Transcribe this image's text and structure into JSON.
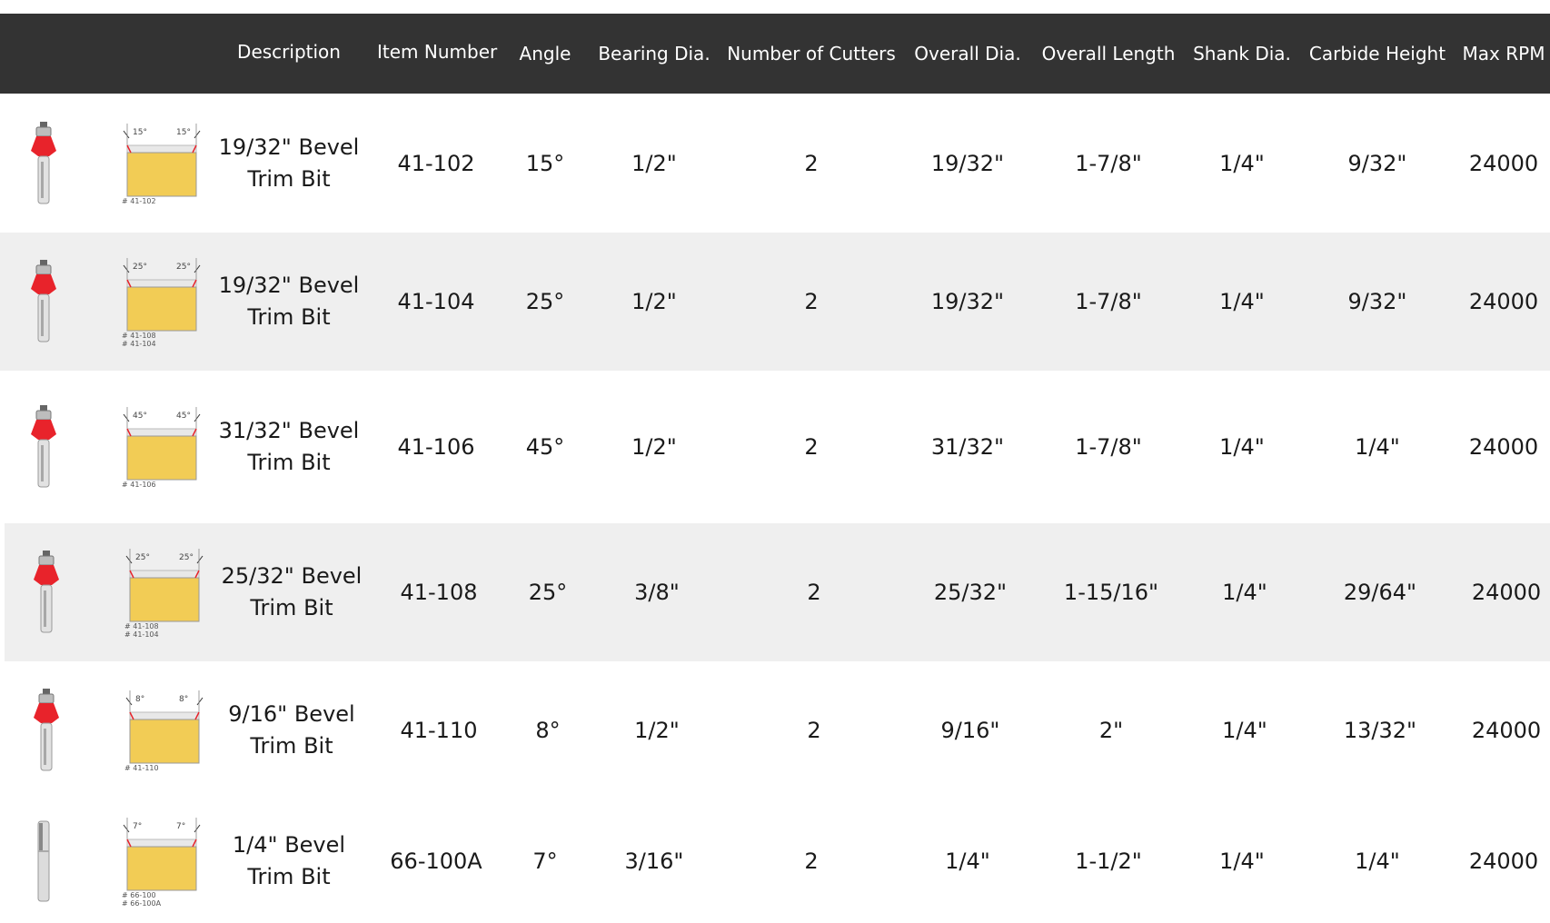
{
  "header": {
    "columns": [
      "",
      "",
      "Description",
      "Item Number",
      "Angle",
      "Bearing Dia.",
      "Number of Cutters",
      "Overall Dia.",
      "Overall Length",
      "Shank Dia.",
      "Carbide Height",
      "Max RPM"
    ]
  },
  "colors": {
    "header_bg": "#333333",
    "header_text": "#ffffff",
    "row_shade": "#efefef",
    "cutter_red": "#e8232b",
    "wood": "#f2cc55"
  },
  "rows": [
    {
      "icon": "bevel-bit-with-bearing-icon",
      "diagram_angle": "15°",
      "diagram_captions": [
        "# 41-102"
      ],
      "description": "19/32\" Bevel Trim Bit",
      "item_number": "41-102",
      "angle": "15°",
      "bearing_dia": "1/2\"",
      "cutters": "2",
      "overall_dia": "19/32\"",
      "overall_length": "1-7/8\"",
      "shank_dia": "1/4\"",
      "carbide_height": "9/32\"",
      "max_rpm": "24000"
    },
    {
      "icon": "bevel-bit-with-bearing-icon",
      "diagram_angle": "25°",
      "diagram_captions": [
        "# 41-108",
        "# 41-104"
      ],
      "description": "19/32\" Bevel Trim Bit",
      "item_number": "41-104",
      "angle": "25°",
      "bearing_dia": "1/2\"",
      "cutters": "2",
      "overall_dia": "19/32\"",
      "overall_length": "1-7/8\"",
      "shank_dia": "1/4\"",
      "carbide_height": "9/32\"",
      "max_rpm": "24000"
    },
    {
      "icon": "bevel-bit-with-bearing-icon",
      "diagram_angle": "45°",
      "diagram_captions": [
        "# 41-106"
      ],
      "description": "31/32\" Bevel Trim Bit",
      "item_number": "41-106",
      "angle": "45°",
      "bearing_dia": "1/2\"",
      "cutters": "2",
      "overall_dia": "31/32\"",
      "overall_length": "1-7/8\"",
      "shank_dia": "1/4\"",
      "carbide_height": "1/4\"",
      "max_rpm": "24000"
    },
    {
      "icon": "bevel-bit-with-bearing-icon",
      "diagram_angle": "25°",
      "diagram_captions": [
        "# 41-108",
        "# 41-104"
      ],
      "description": "25/32\" Bevel Trim Bit",
      "item_number": "41-108",
      "angle": "25°",
      "bearing_dia": "3/8\"",
      "cutters": "2",
      "overall_dia": "25/32\"",
      "overall_length": "1-15/16\"",
      "shank_dia": "1/4\"",
      "carbide_height": "29/64\"",
      "max_rpm": "24000"
    },
    {
      "icon": "bevel-bit-with-bearing-icon",
      "diagram_angle": "8°",
      "diagram_captions": [
        "# 41-110"
      ],
      "description": "9/16\" Bevel Trim Bit",
      "item_number": "41-110",
      "angle": "8°",
      "bearing_dia": "1/2\"",
      "cutters": "2",
      "overall_dia": "9/16\"",
      "overall_length": "2\"",
      "shank_dia": "1/4\"",
      "carbide_height": "13/32\"",
      "max_rpm": "24000"
    },
    {
      "icon": "straight-bit-icon",
      "diagram_angle": "7°",
      "diagram_captions": [
        "# 66-100",
        "# 66-100A"
      ],
      "description": "1/4\" Bevel Trim Bit",
      "item_number": "66-100A",
      "angle": "7°",
      "bearing_dia": "3/16\"",
      "cutters": "2",
      "overall_dia": "1/4\"",
      "overall_length": "1-1/2\"",
      "shank_dia": "1/4\"",
      "carbide_height": "1/4\"",
      "max_rpm": "24000"
    }
  ]
}
